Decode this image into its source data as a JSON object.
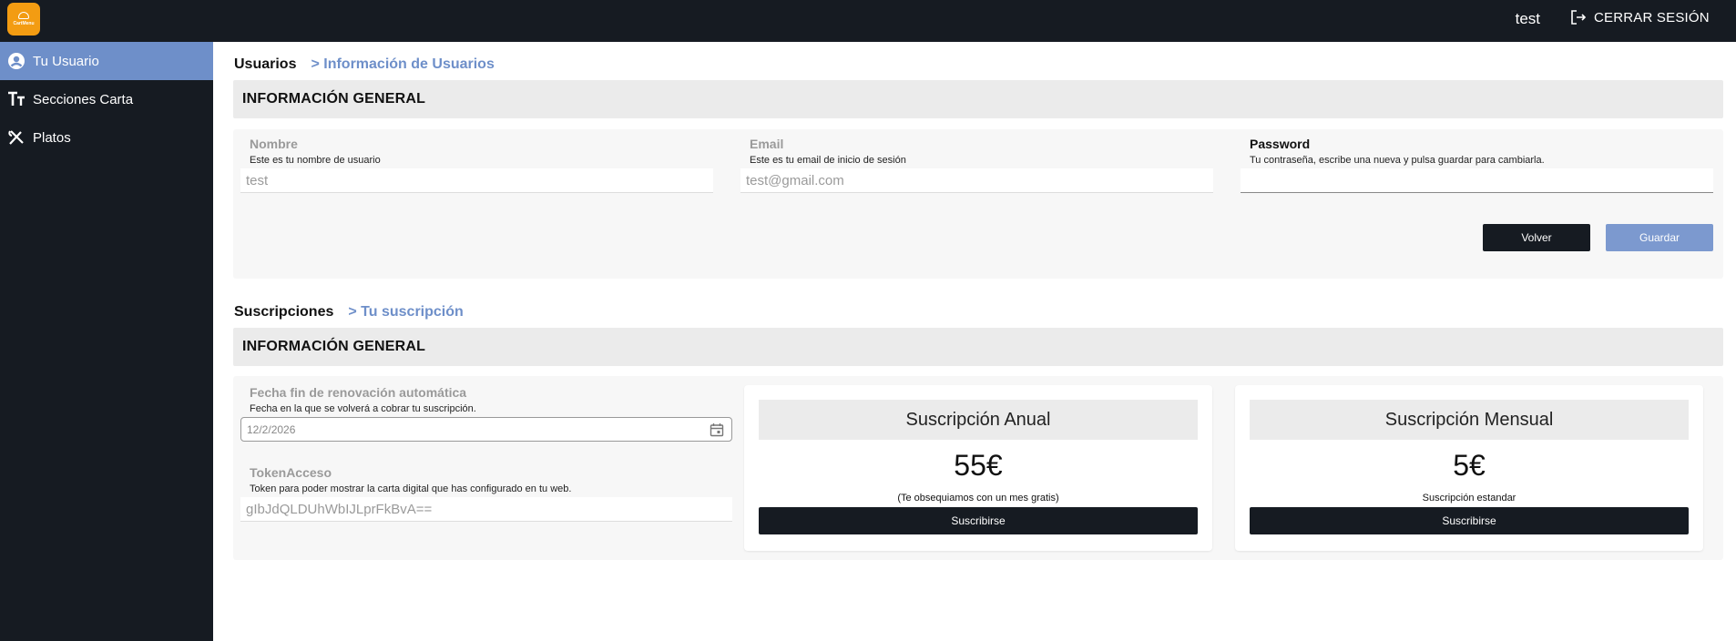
{
  "header": {
    "logo_text": "CartMenu",
    "username": "test",
    "logout_label": "CERRAR SESIÓN"
  },
  "sidebar": {
    "items": [
      {
        "label": "Tu Usuario",
        "icon": "user-circle-icon",
        "active": true
      },
      {
        "label": "Secciones Carta",
        "icon": "text-size-icon",
        "active": false
      },
      {
        "label": "Platos",
        "icon": "cutlery-icon",
        "active": false
      }
    ]
  },
  "users_section": {
    "breadcrumb_root": "Usuarios",
    "breadcrumb_sub": "> Información de Usuarios",
    "heading": "INFORMACIÓN GENERAL",
    "fields": {
      "name": {
        "label": "Nombre",
        "help": "Este es tu nombre de usuario",
        "value": "test"
      },
      "email": {
        "label": "Email",
        "help": "Este es tu email de inicio de sesión",
        "value": "test@gmail.com"
      },
      "password": {
        "label": "Password",
        "help": "Tu contraseña, escribe una nueva y pulsa guardar para cambiarla.",
        "value": ""
      }
    },
    "back_label": "Volver",
    "save_label": "Guardar"
  },
  "subscriptions_section": {
    "breadcrumb_root": "Suscripciones",
    "breadcrumb_sub": "> Tu suscripción",
    "heading": "INFORMACIÓN GENERAL",
    "renewal": {
      "label": "Fecha fin de renovación automática",
      "help": "Fecha en la que se volverá a cobrar tu suscripción.",
      "value": "12/2/2026"
    },
    "token": {
      "label": "TokenAcceso",
      "help": "Token para poder mostrar la carta digital que has configurado en tu web.",
      "value": "gIbJdQLDUhWbIJLprFkBvA=="
    },
    "plans": [
      {
        "title": "Suscripción Anual",
        "price": "55€",
        "note": "(Te obsequiamos con un mes gratis)",
        "button": "Suscribirse"
      },
      {
        "title": "Suscripción Mensual",
        "price": "5€",
        "note": "Suscripción estandar",
        "button": "Suscribirse"
      }
    ]
  },
  "colors": {
    "topbar": "#161b22",
    "sidebar_active": "#6e8fc9",
    "accent": "#6e8fc9",
    "save_button": "#7c99cf",
    "logo": "#f39c12"
  }
}
